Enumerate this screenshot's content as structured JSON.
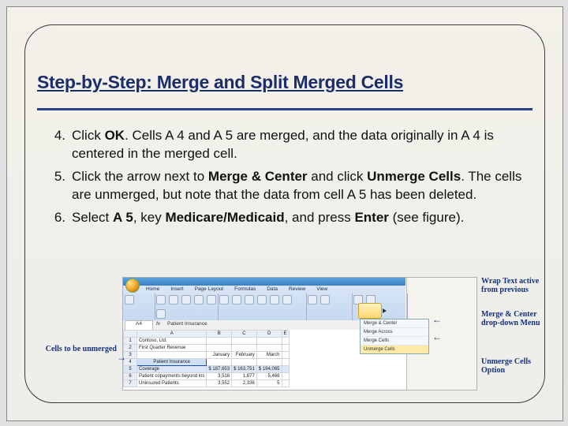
{
  "title": "Step-by-Step: Merge and Split Merged Cells",
  "steps": [
    {
      "n": "4.",
      "parts": [
        {
          "t": "Click "
        },
        {
          "t": "OK",
          "b": true
        },
        {
          "t": ". Cells A 4 and A 5 are merged, and the data originally in A 4 is centered in the merged cell."
        }
      ]
    },
    {
      "n": "5.",
      "parts": [
        {
          "t": "Click the arrow next to "
        },
        {
          "t": "Merge & Center",
          "b": true
        },
        {
          "t": " and click "
        },
        {
          "t": "Unmerge Cells",
          "b": true
        },
        {
          "t": ". The cells are unmerged, but note that the data from cell A 5 has been deleted."
        }
      ]
    },
    {
      "n": "6.",
      "parts": [
        {
          "t": "Select "
        },
        {
          "t": "A 5",
          "b": true
        },
        {
          "t": ", key "
        },
        {
          "t": "Medicare/Medicaid",
          "b": true
        },
        {
          "t": ", and press "
        },
        {
          "t": "Enter",
          "b": true
        },
        {
          "t": " (see figure)."
        }
      ]
    }
  ],
  "fig": {
    "callouts": {
      "cells": "Cells to be unmerged",
      "wrap": "Wrap Text active from previous",
      "merge": "Merge & Center drop-down Menu",
      "unmerge": "Unmerge Cells Option"
    },
    "ribbon": {
      "tabs": [
        "Home",
        "Insert",
        "Page Layout",
        "Formulas",
        "Data",
        "Review",
        "View"
      ],
      "merge_menu": [
        "Merge & Center",
        "Merge Across",
        "Merge Cells",
        "Unmerge Cells"
      ]
    },
    "fx": {
      "name": "A4",
      "val": "Patient Insurance"
    },
    "sheet": {
      "cols": [
        "",
        "A",
        "B",
        "C",
        "D",
        "E"
      ],
      "rows": [
        {
          "n": "1",
          "c": [
            "Contoso, Ltd.",
            "",
            "",
            "",
            ""
          ]
        },
        {
          "n": "2",
          "c": [
            "First Quarter Revenue",
            "",
            "",
            "",
            ""
          ]
        },
        {
          "n": "3",
          "c": [
            "",
            "January",
            "February",
            "March",
            ""
          ]
        },
        {
          "n": "4",
          "c": [
            "Patient Insurance",
            "",
            "",
            "",
            ""
          ],
          "merged": true
        },
        {
          "n": "5",
          "c": [
            "Coverage",
            "$   187,653",
            "$   163,751",
            "$   194,065",
            ""
          ],
          "sel": true
        },
        {
          "n": "6",
          "c": [
            "Patient copayments beyond ins",
            "3,516",
            "1,877",
            "5,466",
            ""
          ]
        },
        {
          "n": "7",
          "c": [
            "Uninsured Patients",
            "3,552",
            "2,336",
            "5",
            ""
          ]
        }
      ]
    }
  }
}
